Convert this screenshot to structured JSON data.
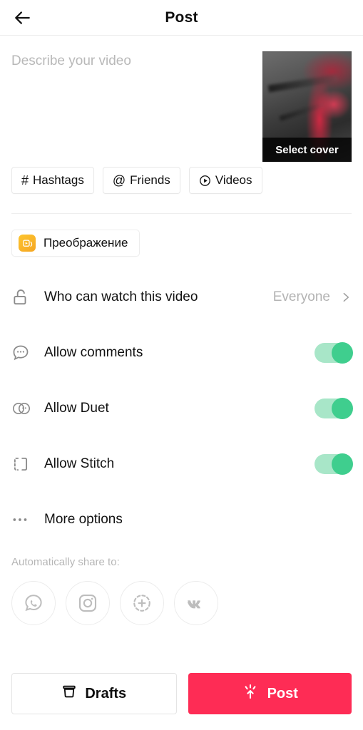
{
  "header": {
    "title": "Post",
    "back_icon": "arrow-left-icon"
  },
  "compose": {
    "description_value": "",
    "description_placeholder": "Describe your video",
    "cover": {
      "label": "Select cover"
    },
    "chips": [
      {
        "glyph": "#",
        "label": "Hashtags",
        "icon": "hashtag-icon"
      },
      {
        "glyph": "@",
        "label": "Friends",
        "icon": "at-mention-icon"
      },
      {
        "glyph": "",
        "label": "Videos",
        "icon": "play-circle-icon"
      }
    ]
  },
  "effect": {
    "label": "Преображение",
    "icon": "effect-play-icon",
    "icon_color": "#f5a623"
  },
  "settings": {
    "privacy": {
      "label": "Who can watch this video",
      "value": "Everyone",
      "icon": "unlock-icon",
      "chevron": "chevron-right-icon"
    },
    "toggles": [
      {
        "label": "Allow comments",
        "icon": "comment-bubble-icon",
        "on": true
      },
      {
        "label": "Allow Duet",
        "icon": "duet-icon",
        "on": true
      },
      {
        "label": "Allow Stitch",
        "icon": "stitch-icon",
        "on": true
      }
    ],
    "more_options": {
      "label": "More options",
      "icon": "ellipsis-icon"
    }
  },
  "share": {
    "label": "Automatically share to:",
    "targets": [
      {
        "name": "WhatsApp",
        "icon": "whatsapp-icon"
      },
      {
        "name": "Instagram",
        "icon": "instagram-icon"
      },
      {
        "name": "Instagram Story",
        "icon": "instagram-story-icon"
      },
      {
        "name": "VK",
        "icon": "vk-icon"
      }
    ]
  },
  "footer": {
    "drafts_label": "Drafts",
    "drafts_icon": "archive-box-icon",
    "post_label": "Post",
    "post_icon": "publish-arrow-icon",
    "post_color": "#fe2c55"
  },
  "colors": {
    "accent": "#fe2c55",
    "toggle_on_track": "#a8e6c8",
    "toggle_on_knob": "#3fce8e",
    "muted_text": "#b3b3b3"
  }
}
